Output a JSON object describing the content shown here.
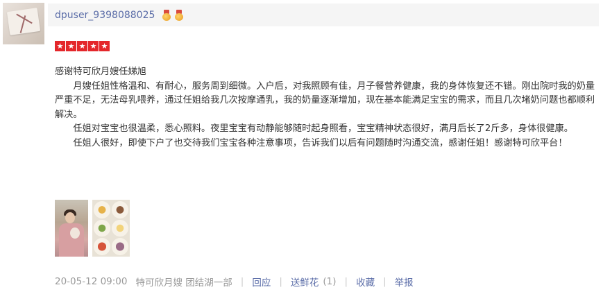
{
  "user": {
    "username": "dpuser_9398088025",
    "medals": [
      "medal-icon",
      "medal-icon"
    ]
  },
  "rating": {
    "stars": 5,
    "max": 5,
    "star_color": "#e4272b"
  },
  "review": {
    "title": "感谢特可欣月嫂任娣旭",
    "paragraphs": [
      "月嫂任姐性格温和、有耐心，服务周到细微。入户后，对我照顾有佳，月子餐营养健康，我的身体恢复还不错。刚出院时我的奶量严重不足，无法母乳喂养，通过任姐给我几次按摩通乳，我的奶量逐渐增加，现在基本能满足宝宝的需求，而且几次堵奶问题也都顺利解决。",
      "任姐对宝宝也很温柔，悉心照料。夜里宝宝有动静能够随时起身照看，宝宝精神状态很好，满月后长了2斤多，身体很健康。",
      "任姐人很好，即使下户了也交待我们宝宝各种注意事项，告诉我们以后有问题随时沟通交流，感谢任姐！感谢特可欣平台！"
    ]
  },
  "photos": [
    "photo-mother-baby",
    "photo-meals"
  ],
  "footer": {
    "date": "20-05-12 09:00",
    "shop": "特可欣月嫂 团结湖一部",
    "reply": "回应",
    "flowers": "送鲜花",
    "flowers_count": "(1)",
    "favorite": "收藏",
    "report": "举报"
  },
  "colors": {
    "link": "#5b6da8",
    "header_bg": "#f5f5f5",
    "meta_text": "#999999"
  }
}
